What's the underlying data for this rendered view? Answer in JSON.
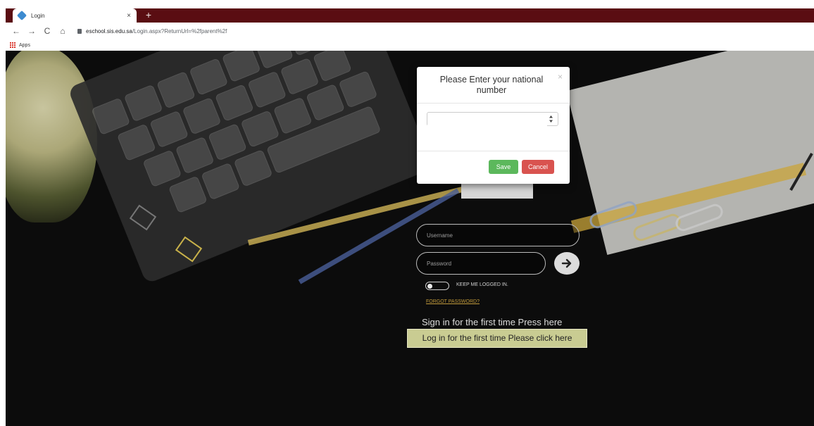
{
  "browser": {
    "tab_title": "Login",
    "tab_close": "×",
    "new_tab": "+",
    "url_host": "eschool.sis.edu.sa",
    "url_path": "/Login.aspx?ReturnUrl=%2fparent%2f",
    "bookmark_apps": "Apps"
  },
  "login": {
    "username_placeholder": "Username",
    "password_placeholder": "Password",
    "keep_logged_in": "KEEP ME LOGGED IN.",
    "forgot_password": "FORGOT PASSWORD?",
    "first_time_text": "Sign in for the first time Press here",
    "first_time_button": "Log in for the first time Please click here"
  },
  "modal": {
    "title": "Please Enter your national number",
    "close": "×",
    "save": "Save",
    "cancel": "Cancel",
    "national_number_value": ""
  },
  "colors": {
    "tab_strip": "#5a0d12",
    "save": "#5cb85c",
    "cancel": "#d9534f",
    "first_time_button": "#c9cc92",
    "forgot_link": "#c19a3b"
  }
}
